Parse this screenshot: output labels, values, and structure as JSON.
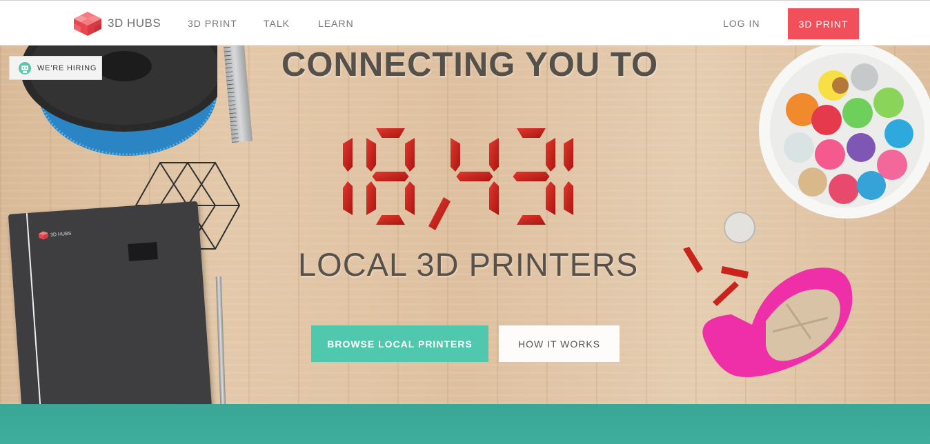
{
  "nav": {
    "logo_text": "3D HUBS",
    "links": [
      {
        "label": "3D PRINT"
      },
      {
        "label": "TALK"
      },
      {
        "label": "LEARN"
      }
    ],
    "login_label": "LOG IN",
    "print_button_label": "3D PRINT"
  },
  "hero": {
    "hiring_label": "WE'RE HIRING",
    "headline": "CONNECTING YOU TO",
    "count": "18,431",
    "subline": "LOCAL 3D PRINTERS",
    "browse_label": "BROWSE LOCAL PRINTERS",
    "how_label": "HOW IT WORKS",
    "notebook_brand": "3D HUBS"
  },
  "colors": {
    "accent_red": "#f1505a",
    "accent_teal": "#50c8ad",
    "band_teal": "#3fad9b",
    "digit_red": "#c8231c"
  },
  "icons": {
    "logo": "cube-logo-icon",
    "hiring": "robot-icon"
  }
}
